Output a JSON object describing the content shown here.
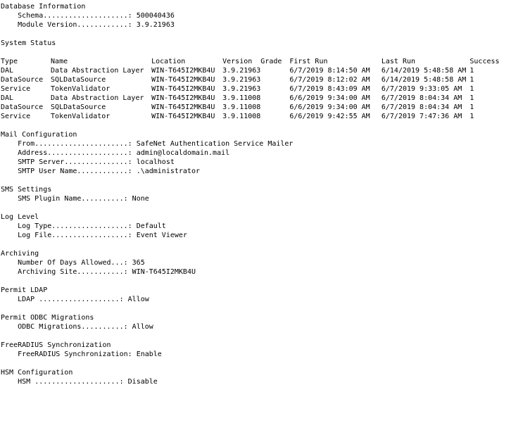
{
  "sections": [
    {
      "id": "database-information",
      "title": "Database Information",
      "rows": [
        {
          "label": "Schema",
          "leader": "....................",
          "value": "500040436"
        },
        {
          "label": "Module Version",
          "leader": "............",
          "value": "3.9.21963"
        }
      ]
    },
    {
      "id": "system-status",
      "title": "System Status",
      "table": {
        "columns": [
          "Type",
          "Name",
          "Location",
          "Version",
          "Grade",
          "First Run",
          "Last Run",
          "Success"
        ],
        "rows": [
          [
            "DAL",
            "Data Abstraction Layer",
            "WIN-T645I2MKB4U",
            "3.9.21963",
            "",
            "6/7/2019 8:14:50 AM",
            "6/14/2019 5:48:58 AM",
            "1"
          ],
          [
            "DataSource",
            "SQLDataSource",
            "WIN-T645I2MKB4U",
            "3.9.21963",
            "",
            "6/7/2019 8:12:02 AM",
            "6/14/2019 5:48:58 AM",
            "1"
          ],
          [
            "Service",
            "TokenValidator",
            "WIN-T645I2MKB4U",
            "3.9.21963",
            "",
            "6/7/2019 8:43:09 AM",
            "6/7/2019 9:33:05 AM",
            "1"
          ],
          [
            "DAL",
            "Data Abstraction Layer",
            "WIN-T645I2MKB4U",
            "3.9.11008",
            "",
            "6/6/2019 9:34:00 AM",
            "6/7/2019 8:04:34 AM",
            "1"
          ],
          [
            "DataSource",
            "SQLDataSource",
            "WIN-T645I2MKB4U",
            "3.9.11008",
            "",
            "6/6/2019 9:34:00 AM",
            "6/7/2019 8:04:34 AM",
            "1"
          ],
          [
            "Service",
            "TokenValidator",
            "WIN-T645I2MKB4U",
            "3.9.11008",
            "",
            "6/6/2019 9:42:55 AM",
            "6/7/2019 7:47:36 AM",
            "1"
          ]
        ]
      }
    },
    {
      "id": "mail-configuration",
      "title": "Mail Configuration",
      "rows": [
        {
          "label": "From",
          "leader": "......................",
          "value": "SafeNet Authentication Service Mailer"
        },
        {
          "label": "Address",
          "leader": "...................",
          "value": "admin@localdomain.mail"
        },
        {
          "label": "SMTP Server",
          "leader": "...............",
          "value": "localhost"
        },
        {
          "label": "SMTP User Name",
          "leader": "............",
          "value": ".\\administrator"
        }
      ]
    },
    {
      "id": "sms-settings",
      "title": "SMS Settings",
      "rows": [
        {
          "label": "SMS Plugin Name",
          "leader": "..........",
          "value": "None"
        }
      ]
    },
    {
      "id": "log-level",
      "title": "Log Level",
      "rows": [
        {
          "label": "Log Type",
          "leader": "..................",
          "value": "Default"
        },
        {
          "label": "Log File",
          "leader": "..................",
          "value": "Event Viewer"
        }
      ]
    },
    {
      "id": "archiving",
      "title": "Archiving",
      "rows": [
        {
          "label": "Number Of Days Allowed",
          "leader": "...",
          "value": "365"
        },
        {
          "label": "Archiving Site",
          "leader": "...........",
          "value": "WIN-T645I2MKB4U"
        }
      ]
    },
    {
      "id": "permit-ldap",
      "title": "Permit LDAP",
      "rows": [
        {
          "label": "LDAP ",
          "leader": "...................",
          "value": "Allow"
        }
      ]
    },
    {
      "id": "permit-odbc-migrations",
      "title": "Permit ODBC Migrations",
      "rows": [
        {
          "label": "ODBC Migrations",
          "leader": "..........",
          "value": "Allow"
        }
      ]
    },
    {
      "id": "freeradius-synchronization",
      "title": "FreeRADIUS Synchronization",
      "rows": [
        {
          "label": "FreeRADIUS Synchronization",
          "leader": "",
          "value": "Enable"
        }
      ]
    },
    {
      "id": "hsm-configuration",
      "title": "HSM Configuration",
      "rows": [
        {
          "label": "HSM ",
          "leader": "....................",
          "value": "Disable"
        }
      ]
    }
  ]
}
